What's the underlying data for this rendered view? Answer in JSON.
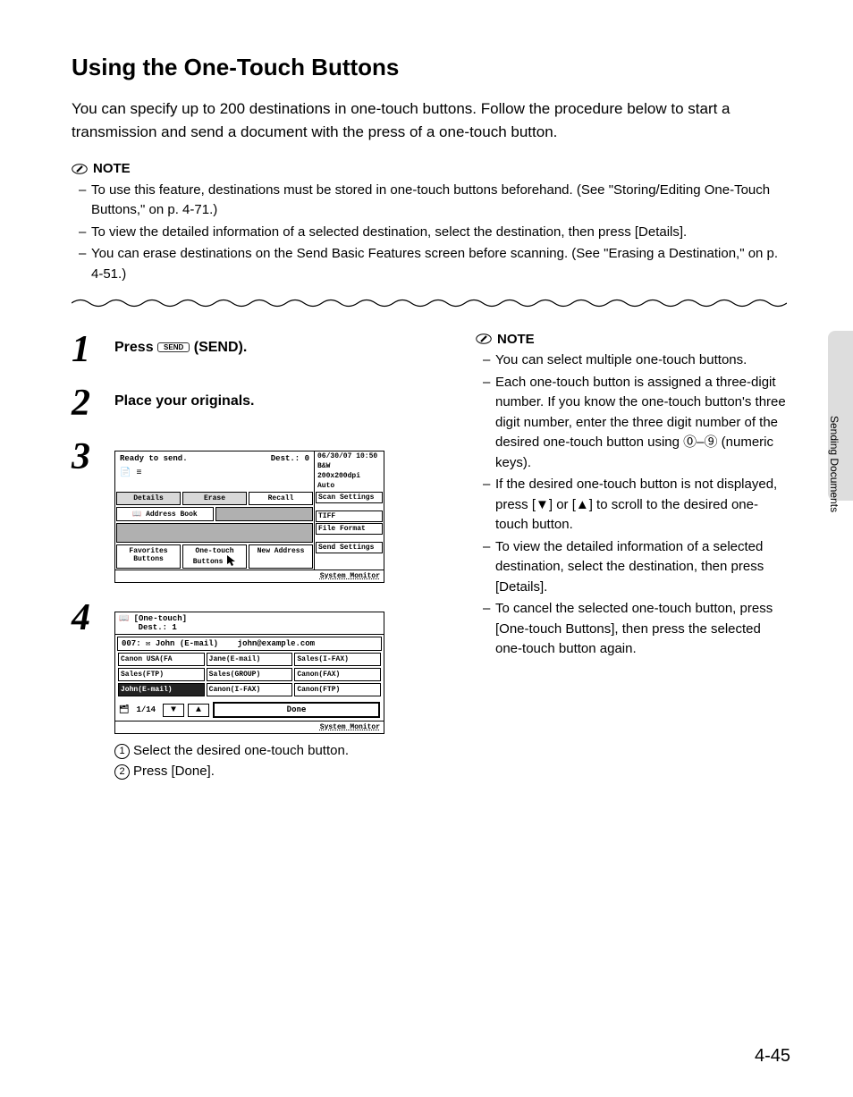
{
  "heading": "Using the One-Touch Buttons",
  "intro": "You can specify up to 200 destinations in one-touch buttons. Follow the procedure below to start a transmission and send a document with the press of a one-touch button.",
  "note_label": "NOTE",
  "top_notes": [
    "To use this feature, destinations must be stored in one-touch buttons beforehand. (See \"Storing/Editing One-Touch Buttons,\" on p. 4-71.)",
    "To view the detailed information of a selected destination, select the destination, then press [Details].",
    "You can erase destinations on the Send Basic Features screen before scanning. (See \"Erasing a Destination,\" on p. 4-51.)"
  ],
  "steps": {
    "s1": {
      "num": "1",
      "pre": "Press ",
      "key": "SEND",
      "post": " (SEND)."
    },
    "s2": {
      "num": "2",
      "text": "Place your originals."
    },
    "s3": {
      "num": "3"
    },
    "s4": {
      "num": "4"
    }
  },
  "screen3": {
    "status": "Ready to send.",
    "dest_label": "Dest.:",
    "dest_count": "0",
    "datetime": "06/30/07 10:50",
    "mode1": "B&W",
    "mode2": "200x200dpi",
    "mode3": "Auto",
    "row1": {
      "a": "Details",
      "b": "Erase",
      "c": "Recall"
    },
    "rp1": "Scan Settings",
    "addr": "Address Book",
    "rp2": "TIFF",
    "rp3": "File Format",
    "row2": {
      "a": "Favorites Buttons",
      "b": "One-touch Buttons",
      "c": "New Address"
    },
    "rp4": "Send Settings",
    "sysmon": "System Monitor"
  },
  "screen4": {
    "title": "[One-touch]",
    "dest_line": "Dest.:  1",
    "selected_line_left": "007:",
    "selected_line_name": "John (E-mail)",
    "selected_line_addr": "john@example.com",
    "cells": [
      "Canon USA(FA",
      "Jane(E-mail)",
      "Sales(I-FAX)",
      "Sales(FTP)",
      "Sales(GROUP)",
      "Canon(FAX)",
      "John(E-mail)",
      "Canon(I-FAX)",
      "Canon(FTP)"
    ],
    "page": "1/14",
    "done": "Done",
    "sysmon": "System Monitor"
  },
  "substeps": {
    "a": "Select the desired one-touch button.",
    "b": "Press [Done]."
  },
  "right_notes": [
    "You can select multiple one-touch buttons.",
    "Each one-touch button is assigned a three-digit number. If you know the one-touch button's three digit number, enter the three digit number of the desired one-touch button using ⓪–⑨ (numeric keys).",
    "If the desired one-touch button is not displayed, press [▼] or [▲] to scroll to the desired one-touch button.",
    "To view the detailed information of a selected destination, select the destination, then press [Details].",
    "To cancel the selected one-touch button, press [One-touch Buttons], then press the selected one-touch button again."
  ],
  "side_tab": "Sending Documents",
  "page_number": "4-45"
}
